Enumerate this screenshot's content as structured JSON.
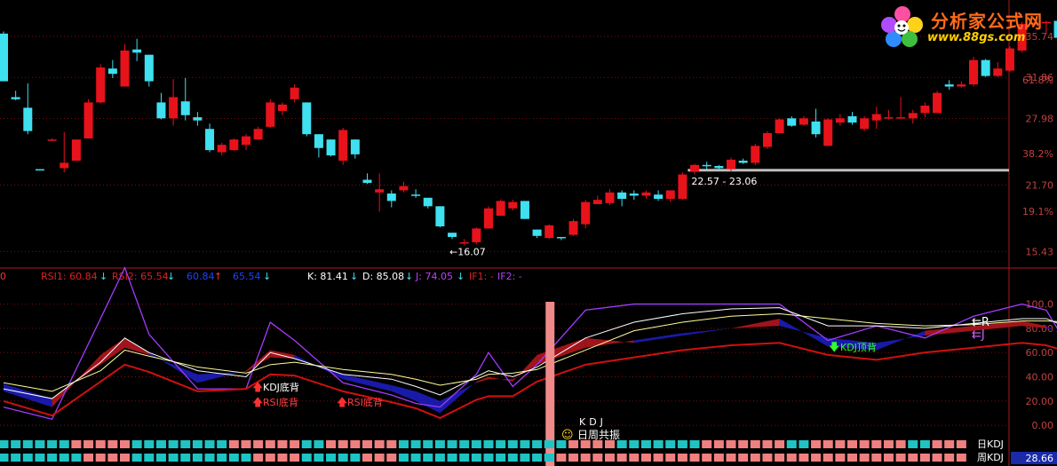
{
  "logo": {
    "title": "分析家公式网",
    "url": "www.88gs.com"
  },
  "colors": {
    "up": "#e8121b",
    "down": "#3fe0f0",
    "grid": "#7a0f0f",
    "frame": "#b01818",
    "label": "#c04040",
    "k": "#ffffff",
    "d": "#ffff9a",
    "j": "#a13cff",
    "rsi_pos": "#a0141c",
    "rsi_neg": "#1a1aa8",
    "pink": "#f08080",
    "cyan_sq": "#1ec4c4",
    "resistance": "#bdbdbd",
    "buy": "#ff3030",
    "sell": "#30ff30"
  },
  "price_axis": {
    "ticks": [
      35.74,
      31.86,
      27.98,
      21.7,
      15.43
    ],
    "tick_labels": [
      "35.74",
      "31.86",
      "27.98",
      "21.70",
      "15.43"
    ],
    "fib_ticks": [
      61.8,
      38.2,
      19.1
    ],
    "fib_labels": [
      "61.8%",
      "38.2%",
      "19.1%"
    ]
  },
  "osc_axis": {
    "ticks": [
      100,
      80,
      60,
      40,
      20,
      0
    ],
    "tick_labels": [
      "100.0",
      "80.00",
      "60.00",
      "40.00",
      "20.00",
      "0.00"
    ]
  },
  "annotations": {
    "low": "←16.07",
    "range": "22.57 - 23.06"
  },
  "indicator_header": [
    {
      "text": "0",
      "color": "#ff3030"
    },
    {
      "text": "RSI1: 60.84",
      "color": "#e02020"
    },
    {
      "text": "↓",
      "color": "#3fe0f0"
    },
    {
      "text": "RSI2: 65.54",
      "color": "#e02020"
    },
    {
      "text": "↓",
      "color": "#3fe0f0"
    },
    {
      "text": "60.84",
      "color": "#2040ff"
    },
    {
      "text": "↑",
      "color": "#ff3030"
    },
    {
      "text": "65.54",
      "color": "#2040ff"
    },
    {
      "text": "↓",
      "color": "#3fe0f0"
    },
    {
      "text": "K: 81.41",
      "color": "#ffffff"
    },
    {
      "text": "↓",
      "color": "#3fe0f0"
    },
    {
      "text": "D: 85.08",
      "color": "#ffffff"
    },
    {
      "text": "↓",
      "color": "#3fe0f0"
    },
    {
      "text": "J: 74.05",
      "color": "#c040ff"
    },
    {
      "text": "↓",
      "color": "#3fe0f0"
    },
    {
      "text": "IF1: -",
      "color": "#e02020"
    },
    {
      "text": "IF2: -",
      "color": "#b040ff"
    }
  ],
  "signals": {
    "kdj_bottom": "KDJ底背",
    "rsi_bottom_1": "RSI底背",
    "rsi_bottom_2": "RSI底背",
    "kdj_label": "KDJ",
    "resonance": "日周共振",
    "kdj_top": "KDJ顶背"
  },
  "right_labels": {
    "r": "R",
    "j": "J",
    "daily": "日KDJ",
    "weekly": "周KDJ",
    "weekly_value": "28.66"
  },
  "chart_data": {
    "type": "candlestick",
    "ohlc": [
      [
        36.0,
        36.2,
        31.5,
        31.5
      ],
      [
        30.0,
        30.6,
        29.7,
        29.8
      ],
      [
        29.0,
        31.3,
        26.5,
        26.8
      ],
      [
        23.2,
        23.2,
        23.1,
        23.1
      ],
      [
        25.9,
        26.1,
        25.9,
        26.0
      ],
      [
        23.3,
        26.7,
        22.9,
        23.8
      ],
      [
        24.0,
        26.0,
        24.0,
        26.0
      ],
      [
        26.1,
        29.8,
        26.1,
        29.5
      ],
      [
        29.5,
        33.1,
        29.4,
        32.8
      ],
      [
        32.7,
        33.5,
        31.8,
        32.2
      ],
      [
        31.0,
        35.0,
        31.0,
        34.4
      ],
      [
        34.5,
        35.5,
        33.4,
        34.2
      ],
      [
        34.0,
        34.0,
        31.0,
        31.5
      ],
      [
        29.5,
        30.4,
        27.9,
        28.0
      ],
      [
        28.0,
        31.7,
        27.3,
        30.0
      ],
      [
        29.6,
        31.8,
        27.8,
        28.3
      ],
      [
        28.1,
        28.6,
        27.3,
        27.8
      ],
      [
        27.0,
        27.5,
        24.8,
        25.0
      ],
      [
        24.8,
        25.7,
        24.5,
        25.5
      ],
      [
        25.0,
        26.1,
        24.9,
        26.0
      ],
      [
        25.5,
        26.5,
        25.0,
        26.3
      ],
      [
        26.0,
        27.2,
        26.0,
        27.0
      ],
      [
        27.2,
        29.8,
        27.1,
        29.5
      ],
      [
        28.7,
        29.5,
        28.3,
        29.3
      ],
      [
        29.8,
        31.2,
        29.5,
        30.9
      ],
      [
        29.5,
        29.5,
        26.3,
        26.5
      ],
      [
        26.5,
        26.5,
        24.3,
        25.2
      ],
      [
        26.0,
        26.0,
        24.4,
        24.5
      ],
      [
        24.0,
        27.1,
        23.6,
        26.9
      ],
      [
        26.0,
        26.0,
        24.2,
        24.6
      ],
      [
        22.2,
        22.8,
        21.8,
        21.9
      ],
      [
        21.0,
        22.8,
        19.2,
        21.3
      ],
      [
        20.9,
        21.2,
        19.6,
        20.2
      ],
      [
        21.2,
        22.0,
        21.0,
        21.6
      ],
      [
        20.8,
        21.3,
        20.5,
        20.7
      ],
      [
        20.5,
        20.5,
        19.5,
        19.7
      ],
      [
        19.7,
        19.7,
        17.7,
        17.8
      ],
      [
        17.2,
        17.2,
        16.6,
        16.8
      ],
      [
        16.3,
        16.6,
        16.0,
        16.3
      ],
      [
        16.3,
        17.7,
        16.1,
        17.6
      ],
      [
        17.6,
        19.7,
        17.6,
        19.5
      ],
      [
        18.8,
        20.3,
        18.8,
        20.2
      ],
      [
        19.5,
        20.3,
        19.3,
        20.1
      ],
      [
        20.2,
        20.2,
        18.5,
        18.5
      ],
      [
        17.5,
        17.5,
        16.7,
        16.9
      ],
      [
        16.7,
        18.0,
        16.6,
        17.9
      ],
      [
        16.8,
        16.8,
        16.5,
        16.7
      ],
      [
        17.0,
        18.5,
        16.9,
        18.3
      ],
      [
        18.0,
        20.3,
        17.6,
        20.1
      ],
      [
        19.9,
        20.7,
        19.9,
        20.3
      ],
      [
        20.0,
        21.3,
        19.8,
        21.0
      ],
      [
        21.0,
        21.2,
        19.7,
        20.4
      ],
      [
        20.9,
        21.2,
        20.3,
        20.7
      ],
      [
        20.7,
        21.2,
        20.4,
        21.0
      ],
      [
        20.8,
        21.2,
        20.2,
        20.4
      ],
      [
        20.4,
        21.2,
        20.1,
        21.2
      ],
      [
        20.4,
        22.9,
        20.3,
        22.7
      ],
      [
        23.0,
        23.7,
        22.7,
        23.6
      ],
      [
        23.6,
        23.9,
        23.2,
        23.5
      ],
      [
        23.5,
        23.6,
        23.2,
        23.3
      ],
      [
        23.2,
        24.3,
        23.0,
        24.1
      ],
      [
        24.0,
        24.2,
        23.7,
        23.8
      ],
      [
        23.8,
        25.6,
        23.6,
        25.4
      ],
      [
        25.3,
        26.8,
        25.1,
        26.6
      ],
      [
        26.6,
        28.0,
        26.6,
        27.9
      ],
      [
        28.0,
        28.2,
        27.2,
        27.3
      ],
      [
        27.4,
        28.2,
        27.3,
        28.0
      ],
      [
        27.7,
        28.9,
        26.2,
        26.5
      ],
      [
        25.4,
        28.0,
        25.4,
        27.9
      ],
      [
        27.6,
        28.4,
        27.3,
        28.0
      ],
      [
        28.2,
        28.6,
        27.4,
        27.6
      ],
      [
        27.0,
        28.2,
        26.8,
        28.0
      ],
      [
        27.8,
        29.1,
        27.0,
        28.4
      ],
      [
        28.0,
        28.8,
        27.9,
        28.1
      ],
      [
        28.0,
        30.0,
        28.0,
        28.1
      ],
      [
        28.0,
        28.8,
        27.5,
        28.5
      ],
      [
        28.5,
        29.5,
        28.1,
        29.2
      ],
      [
        28.5,
        30.6,
        28.5,
        30.4
      ],
      [
        31.2,
        31.6,
        30.7,
        31.0
      ],
      [
        31.0,
        31.5,
        30.9,
        31.2
      ],
      [
        31.2,
        33.8,
        31.0,
        33.5
      ],
      [
        33.5,
        33.6,
        31.9,
        32.0
      ],
      [
        32.0,
        33.3,
        31.9,
        32.7
      ],
      [
        32.5,
        34.8,
        32.4,
        34.6
      ],
      [
        34.4,
        37.1,
        34.2,
        36.9
      ],
      [
        37.0,
        37.1,
        36.9,
        37.0
      ],
      [
        37.0,
        37.2,
        36.0,
        37.1
      ],
      [
        37.2,
        37.2,
        35.1,
        35.6
      ]
    ],
    "resistance": {
      "from_index": 56,
      "price": 23.06
    },
    "low_marker": {
      "index": 37,
      "price": 16.07
    },
    "range_marker": {
      "index": 56,
      "low": 22.57,
      "high": 23.06
    },
    "osc_x": [
      0,
      4,
      8,
      10,
      12,
      16,
      20,
      22,
      24,
      28,
      32,
      34,
      36,
      39,
      40,
      42,
      44,
      48,
      52,
      56,
      60,
      64,
      68,
      72,
      76,
      80,
      84,
      86,
      88
    ],
    "kdj_k": [
      30,
      22,
      52,
      72,
      60,
      45,
      40,
      60,
      55,
      42,
      38,
      32,
      25,
      40,
      45,
      40,
      48,
      72,
      85,
      92,
      96,
      97,
      82,
      82,
      80,
      84,
      88,
      88,
      80
    ],
    "kdj_d": [
      35,
      28,
      45,
      62,
      57,
      48,
      43,
      50,
      52,
      46,
      42,
      38,
      33,
      38,
      42,
      43,
      46,
      62,
      78,
      85,
      90,
      92,
      88,
      84,
      82,
      83,
      86,
      86,
      85
    ],
    "kdj_j": [
      15,
      5,
      88,
      130,
      75,
      30,
      30,
      85,
      70,
      35,
      25,
      18,
      15,
      42,
      60,
      32,
      50,
      95,
      100,
      100,
      100,
      100,
      70,
      82,
      72,
      90,
      100,
      95,
      62
    ],
    "rsi_fast": [
      28,
      15,
      58,
      72,
      60,
      35,
      45,
      62,
      58,
      38,
      28,
      20,
      10,
      36,
      40,
      36,
      58,
      72,
      68,
      74,
      80,
      88,
      65,
      62,
      78,
      82,
      86,
      82,
      70
    ],
    "rsi_slow": [
      34,
      22,
      50,
      64,
      58,
      42,
      44,
      56,
      55,
      42,
      33,
      28,
      20,
      35,
      38,
      38,
      50,
      64,
      70,
      76,
      80,
      82,
      72,
      68,
      74,
      78,
      82,
      80,
      74
    ],
    "bar_daily": [
      "c",
      "c",
      "c",
      "c",
      "c",
      "c",
      "c",
      "c",
      "c",
      "c",
      "c",
      "c",
      "c",
      "c",
      "c",
      "c",
      "c",
      "c",
      "c",
      "c",
      "c",
      "c",
      "c",
      "c",
      "c",
      "c",
      "c",
      "c",
      "c",
      "c",
      "c",
      "c",
      "c",
      "c",
      "c",
      "c",
      "c",
      "c",
      "c",
      "c",
      "c",
      "c",
      "c",
      "c",
      "c",
      "c",
      "c",
      "c",
      "c",
      "c",
      "c",
      "c",
      "c",
      "c",
      "c",
      "c",
      "c",
      "c",
      "c",
      "c",
      "c",
      "c",
      "c",
      "c",
      "c",
      "c",
      "c",
      "c",
      "c",
      "c",
      "c",
      "c",
      "c",
      "c",
      "c",
      "c",
      "c",
      "c",
      "c",
      "c",
      "c",
      "c",
      "c",
      "c",
      "c",
      "c",
      "c",
      "c",
      "c",
      "c"
    ],
    "bar_daily_pink_ranges": [
      [
        6,
        10
      ],
      [
        19,
        24
      ],
      [
        27,
        32
      ],
      [
        47,
        50
      ],
      [
        58,
        64
      ],
      [
        67,
        74
      ],
      [
        77,
        88
      ]
    ],
    "bar_weekly_pink_ranges": [
      [
        7,
        10
      ],
      [
        21,
        24
      ],
      [
        30,
        32
      ],
      [
        46,
        88
      ]
    ],
    "highlight_index": 45,
    "price_ylim": [
      14.2,
      38.5
    ],
    "osc_ylim": [
      -8,
      118
    ]
  }
}
